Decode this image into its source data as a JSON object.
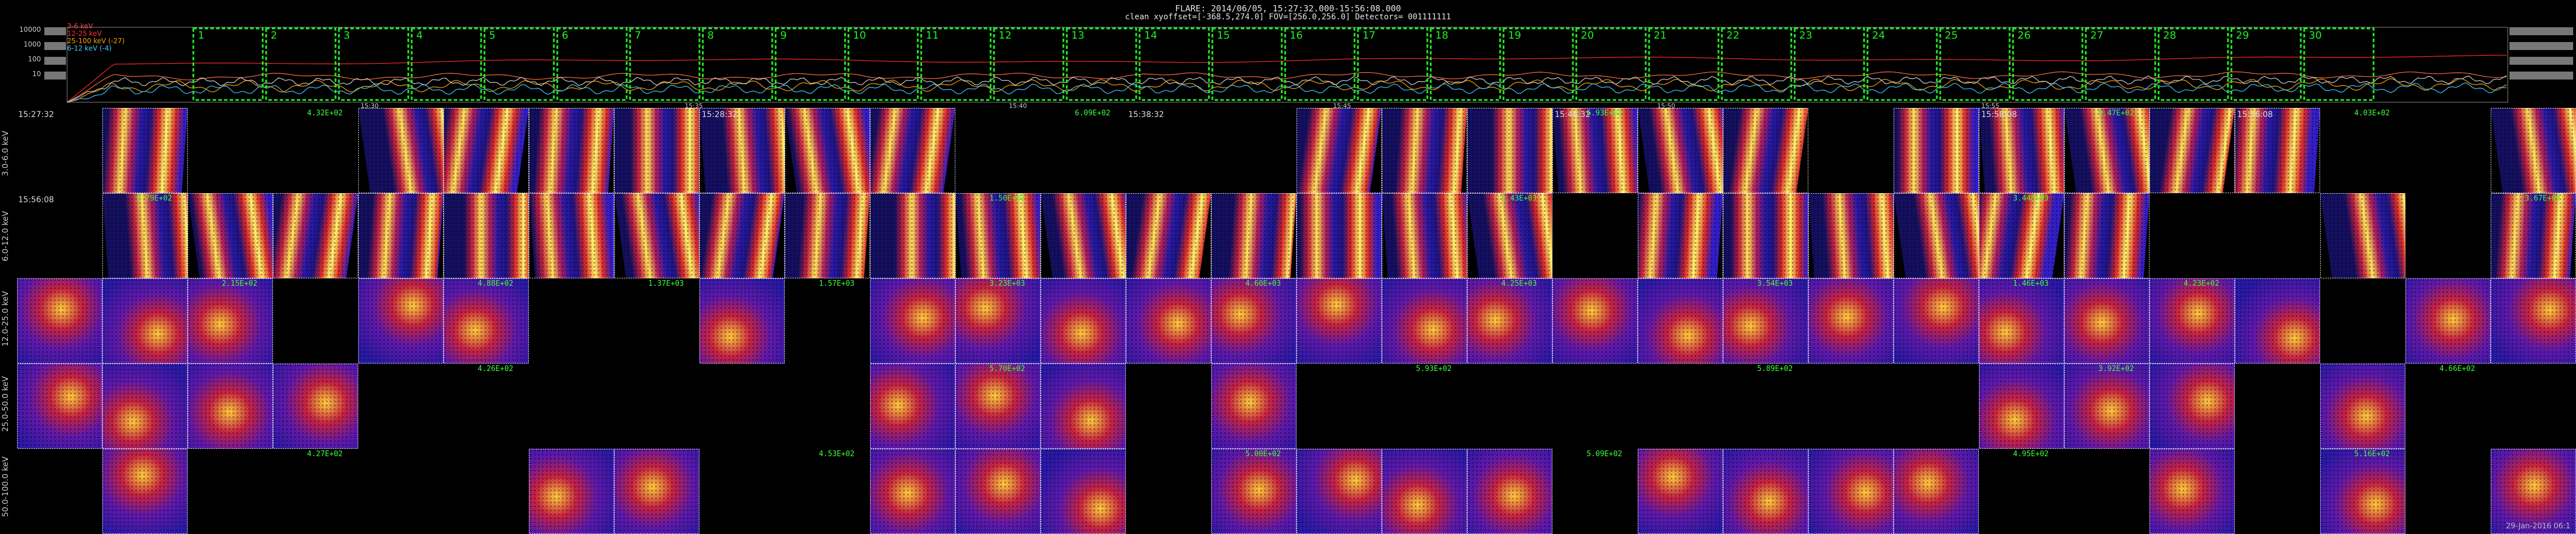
{
  "header": {
    "title": "FLARE: 2014/06/05, 15:27:32.000-15:56:08.000",
    "subtitle": "clean    xyoffset=[-368.5,274.0]    FOV=[256.0,256.0]    Detectors= 001111111"
  },
  "lightcurve": {
    "y_ticks": [
      "10000",
      "1000",
      "100",
      "10"
    ],
    "legend": [
      {
        "text": "3-6 keV",
        "color": "#ff4040"
      },
      {
        "text": "12-25 keV",
        "color": "#ff3030"
      },
      {
        "text": "25-100 keV (-27)",
        "color": "#ffa000"
      },
      {
        "text": "6-12 keV (-4)",
        "color": "#40c8ff"
      }
    ],
    "x_ticks": [
      "15:30",
      "15:35",
      "15:40",
      "15:45",
      "15:50",
      "15:55"
    ],
    "intervals": [
      "1",
      "2",
      "3",
      "4",
      "5",
      "6",
      "7",
      "8",
      "9",
      "10",
      "11",
      "12",
      "13",
      "14",
      "15",
      "16",
      "17",
      "18",
      "19",
      "20",
      "21",
      "22",
      "23",
      "24",
      "25",
      "26",
      "27",
      "28",
      "29",
      "30"
    ]
  },
  "rows": [
    {
      "label": "3.0-6.0 keV",
      "time": "15:27:32"
    },
    {
      "label": "6.0-12.0 keV",
      "time": "15:56:08"
    },
    {
      "label": "12.0-25.0 keV",
      "time": ""
    },
    {
      "label": "25.0-50.0 keV",
      "time": ""
    },
    {
      "label": "50.0-100.0 keV",
      "time": ""
    }
  ],
  "tile_times": [
    "15:28:32",
    "15:38:32",
    "15:48:32",
    "15:58:08",
    "15:56:08"
  ],
  "fluxes": [
    "4.32E+02",
    "6.09E+02",
    "6.93E+02",
    "9.47E+02",
    "4.03E+02",
    "8.79E+02",
    "1.50E+03",
    "3.43E+03",
    "3.44E+03",
    "3.67E+03",
    "2.15E+02",
    "4.88E+02",
    "1.37E+03",
    "1.57E+03",
    "3.23E+03",
    "4.60E+03",
    "4.25E+03",
    "3.54E+03",
    "1.46E+03",
    "4.23E+02",
    "4.26E+02",
    "5.70E+02",
    "5.93E+02",
    "5.89E+02",
    "3.92E+02",
    "4.66E+02",
    "4.27E+02",
    "4.53E+02",
    "5.00E+02",
    "5.09E+02",
    "4.95E+02",
    "5.16E+02"
  ],
  "footer": "29-Jan-2016 06:1"
}
